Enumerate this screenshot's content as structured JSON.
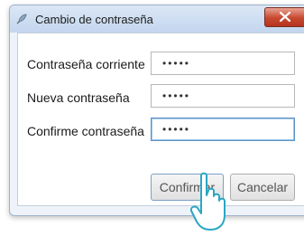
{
  "window": {
    "title": "Cambio de contraseña",
    "app_icon": "feather-icon",
    "close_icon": "close-icon"
  },
  "form": {
    "current_password": {
      "label": "Contraseña corriente",
      "value": "•••••"
    },
    "new_password": {
      "label": "Nueva contraseña",
      "value": "•••••"
    },
    "confirm_password": {
      "label": "Confirme contraseña",
      "value": "•••••"
    }
  },
  "buttons": {
    "confirm": "Confirmar",
    "cancel": "Cancelar"
  },
  "overlay": {
    "pointer": "hand-pointer-icon"
  }
}
